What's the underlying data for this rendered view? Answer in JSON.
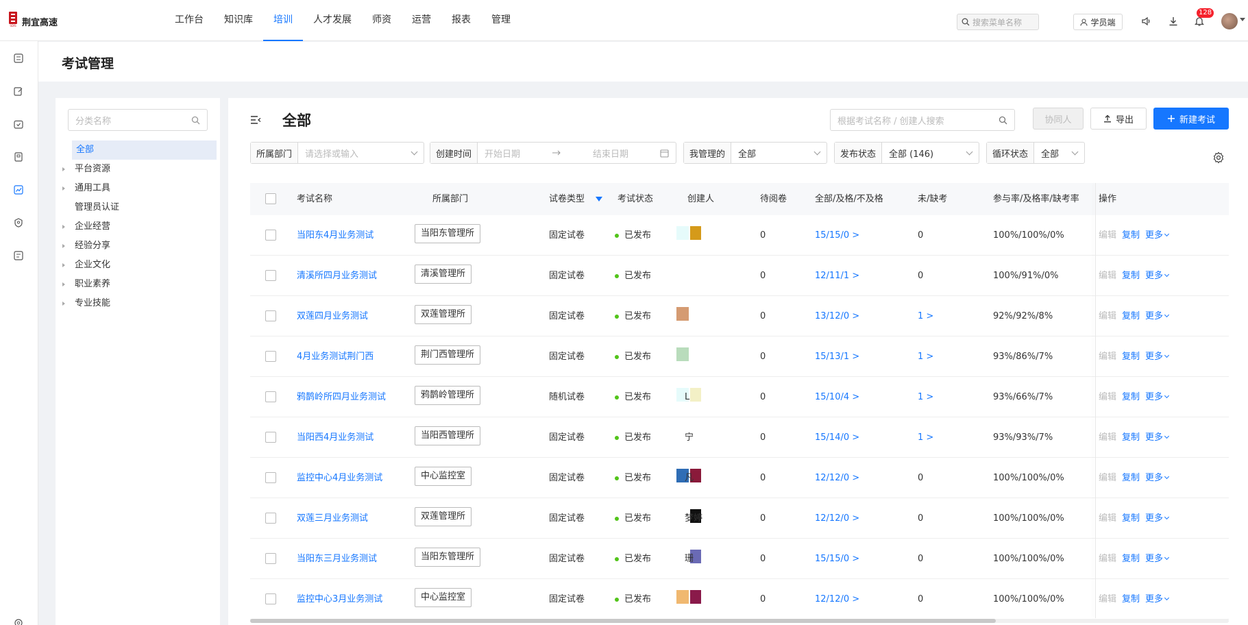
{
  "brand": {
    "name": "荆宜高速"
  },
  "nav": [
    {
      "label": "工作台",
      "active": false
    },
    {
      "label": "知识库",
      "active": false
    },
    {
      "label": "培训",
      "active": true
    },
    {
      "label": "人才发展",
      "active": false
    },
    {
      "label": "师资",
      "active": false
    },
    {
      "label": "运营",
      "active": false
    },
    {
      "label": "报表",
      "active": false
    },
    {
      "label": "管理",
      "active": false
    }
  ],
  "header_tools": {
    "menu_search_placeholder": "搜索菜单名称",
    "student_label": "学员端",
    "notification_count": "128"
  },
  "page": {
    "title": "考试管理"
  },
  "category": {
    "search_placeholder": "分类名称",
    "items": [
      {
        "label": "全部",
        "active": true,
        "expandable": false
      },
      {
        "label": "平台资源",
        "expandable": true
      },
      {
        "label": "通用工具",
        "expandable": true
      },
      {
        "label": "管理员认证",
        "expandable": false
      },
      {
        "label": "企业经营",
        "expandable": true
      },
      {
        "label": "经验分享",
        "expandable": true
      },
      {
        "label": "企业文化",
        "expandable": true
      },
      {
        "label": "职业素养",
        "expandable": true
      },
      {
        "label": "专业技能",
        "expandable": true
      }
    ]
  },
  "main": {
    "title": "全部",
    "search_placeholder": "根据考试名称 / 创建人搜索",
    "collab_label": "协同人",
    "export_label": "导出",
    "new_label": "新建考试"
  },
  "filters": {
    "dept": {
      "label": "所属部门",
      "placeholder": "请选择或输入"
    },
    "created": {
      "label": "创建时间",
      "start": "开始日期",
      "end": "结束日期"
    },
    "managed": {
      "label": "我管理的",
      "value": "全部"
    },
    "publish": {
      "label": "发布状态",
      "value": "全部 (146)"
    },
    "cycle": {
      "label": "循环状态",
      "value": "全部"
    }
  },
  "table": {
    "headers": {
      "name": "考试名称",
      "dept": "所属部门",
      "paper": "试卷类型",
      "status": "考试状态",
      "creator": "创建人",
      "pending": "待阅卷",
      "pass": "全部/及格/不及格",
      "absent": "未/缺考",
      "rate": "参与率/及格率/缺考率",
      "ops": "操作"
    },
    "ops": {
      "edit": "编辑",
      "copy": "复制",
      "more": "更多"
    },
    "rows": [
      {
        "name": "当阳东4月业务测试",
        "dept": "当阳东管理所",
        "paper": "固定试卷",
        "status": "已发布",
        "creator_text": "",
        "pending": "0",
        "pass": "15/15/0 >",
        "absent": "0",
        "absent_link": false,
        "rate": "100%/100%/0%",
        "c1": "#e6fbfb",
        "c2": "#d59a1a"
      },
      {
        "name": "清溪所四月业务测试",
        "dept": "清溪管理所",
        "paper": "固定试卷",
        "status": "已发布",
        "creator_text": "",
        "pending": "0",
        "pass": "12/11/1 >",
        "absent": "0",
        "absent_link": false,
        "rate": "100%/91%/0%",
        "c1": "",
        "c2": ""
      },
      {
        "name": "双莲四月业务测试",
        "dept": "双莲管理所",
        "paper": "固定试卷",
        "status": "已发布",
        "creator_text": "",
        "pending": "0",
        "pass": "13/12/0 >",
        "absent": "1 >",
        "absent_link": true,
        "rate": "92%/92%/8%",
        "c1": "#d59b72",
        "c2": ""
      },
      {
        "name": "4月业务测试荆门西",
        "dept": "荆门西管理所",
        "paper": "固定试卷",
        "status": "已发布",
        "creator_text": "",
        "pending": "0",
        "pass": "15/13/1 >",
        "absent": "1 >",
        "absent_link": true,
        "rate": "93%/86%/7%",
        "c1": "#b9dcbc",
        "c2": ""
      },
      {
        "name": "鸦鹊岭所四月业务测试",
        "dept": "鸦鹊岭管理所",
        "paper": "随机试卷",
        "status": "已发布",
        "creator_text": "L",
        "pending": "0",
        "pass": "15/10/4 >",
        "absent": "1 >",
        "absent_link": true,
        "rate": "93%/66%/7%",
        "c1": "#e6fbfb",
        "c2": "#f3f0c6"
      },
      {
        "name": "当阳西4月业务测试",
        "dept": "当阳西管理所",
        "paper": "固定试卷",
        "status": "已发布",
        "creator_text": "宁",
        "pending": "0",
        "pass": "15/14/0 >",
        "absent": "1 >",
        "absent_link": true,
        "rate": "93%/93%/7%",
        "c1": "",
        "c2": ""
      },
      {
        "name": "监控中心4月业务测试",
        "dept": "中心监控室",
        "paper": "固定试卷",
        "status": "已发布",
        "creator_text": "凡",
        "pending": "0",
        "pass": "12/12/0 >",
        "absent": "0",
        "absent_link": false,
        "rate": "100%/100%/0%",
        "c1": "#2f6db5",
        "c2": "#8a1a3a"
      },
      {
        "name": "双莲三月业务测试",
        "dept": "双莲管理所",
        "paper": "固定试卷",
        "status": "已发布",
        "creator_text": "梦婷",
        "pending": "0",
        "pass": "12/12/0 >",
        "absent": "0",
        "absent_link": false,
        "rate": "100%/100%/0%",
        "c1": "",
        "c2": "#111111"
      },
      {
        "name": "当阳东三月业务测试",
        "dept": "当阳东管理所",
        "paper": "固定试卷",
        "status": "已发布",
        "creator_text": "珊",
        "pending": "0",
        "pass": "15/15/0 >",
        "absent": "0",
        "absent_link": false,
        "rate": "100%/100%/0%",
        "c1": "",
        "c2": "#6a6ab5"
      },
      {
        "name": "监控中心3月业务测试",
        "dept": "中心监控室",
        "paper": "固定试卷",
        "status": "已发布",
        "creator_text": "",
        "pending": "0",
        "pass": "12/12/0 >",
        "absent": "0",
        "absent_link": false,
        "rate": "100%/100%/0%",
        "c1": "#f0b870",
        "c2": "#8a1a4a"
      }
    ]
  }
}
